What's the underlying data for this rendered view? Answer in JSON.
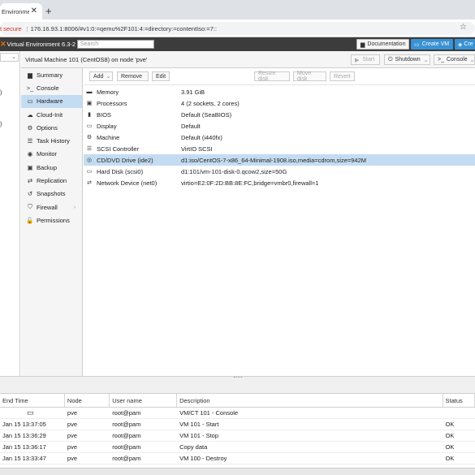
{
  "browser": {
    "tab_title": "Environme",
    "tab_close": "✕",
    "new_tab": "+",
    "addr_secure": "t secure",
    "addr_url": "176.16.93.1:8006/#v1:0:=qemu%2F101:4:=directory:=contentIso:=7::",
    "bookmark_icon": "star-icon"
  },
  "header": {
    "product": "Virtual Environment 6.3-2",
    "search_placeholder": "Search",
    "documentation_label": "Documentation",
    "create_vm_label": "Create VM",
    "create_ct_label": "Cre"
  },
  "tree": {
    "items": [
      ")",
      ")"
    ]
  },
  "vm": {
    "title": "Virtual Machine 101 (CentOS8) on node 'pve'",
    "start_label": "Start",
    "shutdown_label": "Shutdown",
    "console_label": "Console"
  },
  "menu": [
    {
      "label": "Summary",
      "icon": "book-icon",
      "glyph": "▆",
      "active": false
    },
    {
      "label": "Console",
      "icon": "terminal-icon",
      "glyph": ">_",
      "active": false
    },
    {
      "label": "Hardware",
      "icon": "desktop-icon",
      "glyph": "▭",
      "active": true
    },
    {
      "label": "Cloud-Init",
      "icon": "cloud-icon",
      "glyph": "☁",
      "active": false
    },
    {
      "label": "Options",
      "icon": "gear-icon",
      "glyph": "⚙",
      "active": false
    },
    {
      "label": "Task History",
      "icon": "list-icon",
      "glyph": "☰",
      "active": false
    },
    {
      "label": "Monitor",
      "icon": "eye-icon",
      "glyph": "◉",
      "active": false
    },
    {
      "label": "Backup",
      "icon": "floppy-icon",
      "glyph": "▣",
      "active": false
    },
    {
      "label": "Replication",
      "icon": "retweet-icon",
      "glyph": "⇄",
      "active": false
    },
    {
      "label": "Snapshots",
      "icon": "history-icon",
      "glyph": "↺",
      "active": false
    },
    {
      "label": "Firewall",
      "icon": "shield-icon",
      "glyph": "⛉",
      "active": false
    },
    {
      "label": "Permissions",
      "icon": "unlock-icon",
      "glyph": "🔓",
      "active": false
    }
  ],
  "toolbar": {
    "add_label": "Add",
    "remove_label": "Remove",
    "edit_label": "Edit",
    "resize_label": "Resize disk",
    "move_label": "Move disk",
    "revert_label": "Revert"
  },
  "hardware": [
    {
      "name": "Memory",
      "value": "3.91 GiB",
      "icon": "memory-icon",
      "glyph": "▬",
      "selected": false
    },
    {
      "name": "Processors",
      "value": "4 (2 sockets, 2 cores)",
      "icon": "cpu-icon",
      "glyph": "▣",
      "selected": false
    },
    {
      "name": "BIOS",
      "value": "Default (SeaBIOS)",
      "icon": "microchip-icon",
      "glyph": "▮",
      "selected": false
    },
    {
      "name": "Display",
      "value": "Default",
      "icon": "desktop-icon",
      "glyph": "▭",
      "selected": false
    },
    {
      "name": "Machine",
      "value": "Default (i440fx)",
      "icon": "cogs-icon",
      "glyph": "⚙",
      "selected": false
    },
    {
      "name": "SCSI Controller",
      "value": "VirtIO SCSI",
      "icon": "database-icon",
      "glyph": "☰",
      "selected": false
    },
    {
      "name": "CD/DVD Drive (ide2)",
      "value": "d1:iso/CentOS-7-x86_64-Minimal-1908.iso,media=cdrom,size=942M",
      "icon": "cdrom-icon",
      "glyph": "◎",
      "selected": true
    },
    {
      "name": "Hard Disk (scsi0)",
      "value": "d1:101/vm-101-disk-0.qcow2,size=50G",
      "icon": "hdd-icon",
      "glyph": "▭",
      "selected": false
    },
    {
      "name": "Network Device (net0)",
      "value": "virtio=E2:0F:2D:BB:8E:FC,bridge=vmbr0,firewall=1",
      "icon": "exchange-icon",
      "glyph": "⇄",
      "selected": false
    }
  ],
  "tasks": {
    "headers": [
      "End Time",
      "Node",
      "User name",
      "Description",
      "Status"
    ],
    "rows": [
      {
        "end": "",
        "node": "pve",
        "user": "root@pam",
        "desc": "VM/CT 101 - Console",
        "status": ""
      },
      {
        "end": "Jan 15 13:37:05",
        "node": "pve",
        "user": "root@pam",
        "desc": "VM 101 - Start",
        "status": "OK"
      },
      {
        "end": "Jan 15 13:36:29",
        "node": "pve",
        "user": "root@pam",
        "desc": "VM 101 - Stop",
        "status": "OK"
      },
      {
        "end": "Jan 15 13:36:17",
        "node": "pve",
        "user": "root@pam",
        "desc": "Copy data",
        "status": "OK"
      },
      {
        "end": "Jan 15 13:33:47",
        "node": "pve",
        "user": "root@pam",
        "desc": "VM 100 - Destroy",
        "status": "OK"
      }
    ]
  },
  "colors": {
    "accent": "#3892d4",
    "header_bg": "#3c3c3c",
    "selection": "#c4dcf2",
    "brand": "#e57000"
  }
}
